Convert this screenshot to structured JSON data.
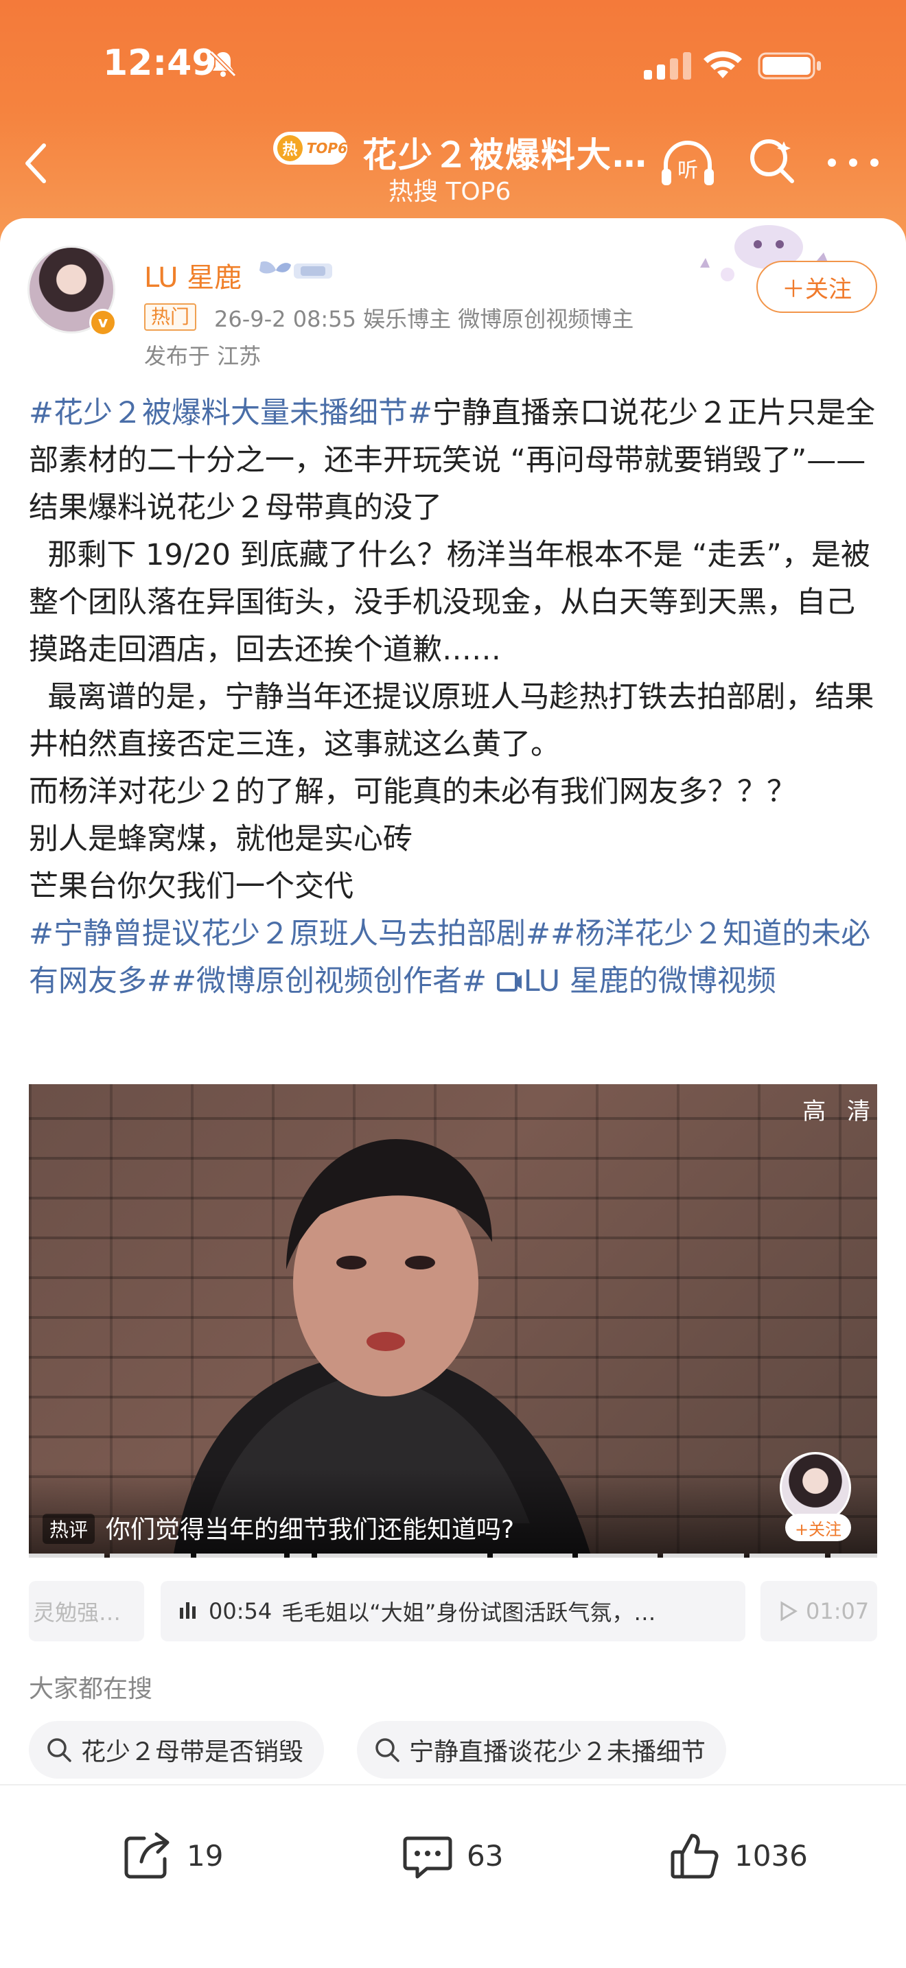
{
  "status_bar": {
    "time": "12:49"
  },
  "nav": {
    "hot_badge_glyph": "热",
    "hot_badge_rank": "TOP6",
    "title": "花少２被爆料大…",
    "subtitle": "热搜 TOP6",
    "listen_label": "听"
  },
  "post": {
    "author": "LU 星鹿",
    "verified_glyph": "v",
    "hot_tag": "热门",
    "meta": "26-9-2 08:55  娱乐博主 微博原创视频博主",
    "location": "发布于 江苏",
    "follow_label": "＋关注",
    "paragraphs": [
      {
        "tag": "#花少２被爆料大量未播细节#",
        "text": "宁静直播亲口说花少２正片只是全部素材的二十分之一，还丰开玩笑说 “再问母带就要销毁了”——结果爆料说花少２母带真的没了"
      },
      {
        "tag": "",
        "text": "  那剩下 19/20 到底藏了什么？杨洋当年根本不是 “走丢”，是被整个团队落在异国街头，没手机没现金，从白天等到天黑，自己摸路走回酒店，回去还挨个道歉……"
      },
      {
        "tag": "",
        "text": "  最离谱的是，宁静当年还提议原班人马趁热打铁去拍部剧，结果井柏然直接否定三连，这事就这么黄了。"
      },
      {
        "tag": "",
        "text": "而杨洋对花少２的了解，可能真的未必有我们网友多？？？"
      },
      {
        "tag": "",
        "text": "别人是蜂窝煤，就他是实心砖"
      },
      {
        "tag": "",
        "text": "芒果台你欠我们一个交代"
      }
    ],
    "tags_line": {
      "tag1": "#宁静曾提议花少２原班人马去拍部剧#",
      "tag2": "#杨洋花少２知道的未必有网友多#",
      "tag3": "#微博原创视频创作者#",
      "video_link": "LU 星鹿的微博视频"
    }
  },
  "video": {
    "quality_label": "高 清",
    "hot_comment_badge": "热评",
    "hot_comment_text": "你们觉得当年的细节我们还能知道吗?",
    "creator_follow": "+关注"
  },
  "chapters": [
    {
      "text": "灵勉强…"
    },
    {
      "time": "00:54",
      "text": "毛毛姐以“大姐”身份试图活跃气氛，…"
    },
    {
      "time": "01:07",
      "text": ""
    }
  ],
  "search_section": {
    "title": "大家都在搜",
    "chips": [
      "花少２母带是否销毁",
      "宁静直播谈花少２未播细节"
    ]
  },
  "actions": {
    "repost": "19",
    "comment": "63",
    "like": "1036"
  },
  "colors": {
    "accent": "#f47a3a",
    "link": "#4a6ea8",
    "author": "#f0802a"
  }
}
